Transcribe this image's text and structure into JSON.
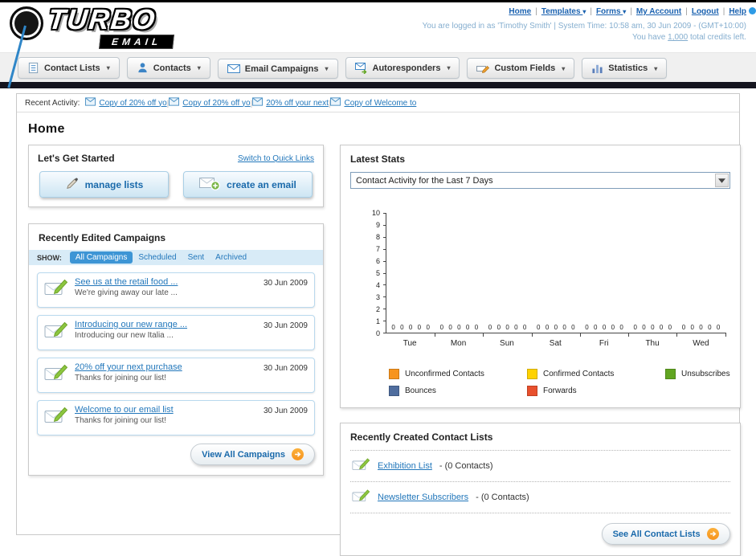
{
  "header": {
    "logo_text": "TURBO",
    "logo_sub": "EMAIL",
    "top_links": [
      {
        "label": "Home",
        "dropdown": false
      },
      {
        "label": "Templates",
        "dropdown": true
      },
      {
        "label": "Forms",
        "dropdown": true
      },
      {
        "label": "My Account",
        "dropdown": false
      },
      {
        "label": "Logout",
        "dropdown": false
      },
      {
        "label": "Help",
        "dropdown": false
      }
    ],
    "login_info": "You are logged in as 'Timothy Smith' | System Time: 10:58 am, 30 Jun 2009 - (GMT+10:00)",
    "credits": {
      "prefix": "You have ",
      "value": "1,000",
      "suffix": " total credits left."
    }
  },
  "main_nav": {
    "items": [
      {
        "label": "Contact Lists",
        "icon": "contact-lists-icon"
      },
      {
        "label": "Contacts",
        "icon": "contacts-icon"
      },
      {
        "label": "Email Campaigns",
        "icon": "email-campaigns-icon"
      },
      {
        "label": "Autoresponders",
        "icon": "autoresponders-icon"
      },
      {
        "label": "Custom Fields",
        "icon": "custom-fields-icon"
      },
      {
        "label": "Statistics",
        "icon": "statistics-icon"
      }
    ]
  },
  "recent_activity": {
    "label": "Recent Activity:",
    "items": [
      "Copy of 20% off yo",
      "Copy of 20% off yo",
      "20% off your next",
      "Copy of Welcome to"
    ]
  },
  "page": {
    "title": "Home"
  },
  "get_started": {
    "title": "Let's Get Started",
    "switch_link": "Switch to Quick Links",
    "manage_lists_label": "manage lists",
    "create_email_label": "create an email"
  },
  "campaigns": {
    "title": "Recently Edited Campaigns",
    "show_label": "SHOW:",
    "tabs": [
      {
        "label": "All Campaigns",
        "active": true
      },
      {
        "label": "Scheduled",
        "active": false
      },
      {
        "label": "Sent",
        "active": false
      },
      {
        "label": "Archived",
        "active": false
      }
    ],
    "items": [
      {
        "title": "See us at the retail food ...",
        "subtitle": "We're giving away our late ...",
        "date": "30 Jun 2009"
      },
      {
        "title": "Introducing our new range ...",
        "subtitle": "Introducing our new Italia ...",
        "date": "30 Jun 2009"
      },
      {
        "title": "20% off your next purchase",
        "subtitle": "Thanks for joining our list!",
        "date": "30 Jun 2009"
      },
      {
        "title": "Welcome to our email list",
        "subtitle": "Thanks for joining our list!",
        "date": "30 Jun 2009"
      }
    ],
    "view_all_label": "View All Campaigns"
  },
  "latest_stats": {
    "title": "Latest Stats",
    "period_selector": "Contact Activity for the Last 7 Days",
    "chart_data": {
      "type": "bar",
      "title": "Contact Activity for the Last 7 Days",
      "categories": [
        "Tue",
        "Mon",
        "Sun",
        "Sat",
        "Fri",
        "Thu",
        "Wed"
      ],
      "series": [
        {
          "name": "Unconfirmed Contacts",
          "color": "#f7941d",
          "values": [
            0,
            0,
            0,
            0,
            0,
            0,
            0
          ]
        },
        {
          "name": "Confirmed Contacts",
          "color": "#ffd200",
          "values": [
            0,
            0,
            0,
            0,
            0,
            0,
            0
          ]
        },
        {
          "name": "Unsubscribes",
          "color": "#61a521",
          "values": [
            0,
            0,
            0,
            0,
            0,
            0,
            0
          ]
        },
        {
          "name": "Bounces",
          "color": "#4f6d9e",
          "values": [
            0,
            0,
            0,
            0,
            0,
            0,
            0
          ]
        },
        {
          "name": "Forwards",
          "color": "#e8502d",
          "values": [
            0,
            0,
            0,
            0,
            0,
            0,
            0
          ]
        }
      ],
      "ylim": [
        0,
        10
      ],
      "yticks": [
        0,
        1,
        2,
        3,
        4,
        5,
        6,
        7,
        8,
        9,
        10
      ],
      "grid": false,
      "value_labels_shown": true,
      "legend_position": "bottom"
    }
  },
  "contact_lists": {
    "title": "Recently Created Contact Lists",
    "items": [
      {
        "name": "Exhibition List",
        "detail": " - (0 Contacts)"
      },
      {
        "name": "Newsletter Subscribers",
        "detail": " - (0 Contacts)"
      }
    ],
    "see_all_label": "See All Contact Lists"
  },
  "colors": {
    "link_blue": "#2277bb",
    "button_text_blue": "#1a6aab",
    "accent_orange": "#f7941d",
    "dark_bar": "#15151f"
  }
}
